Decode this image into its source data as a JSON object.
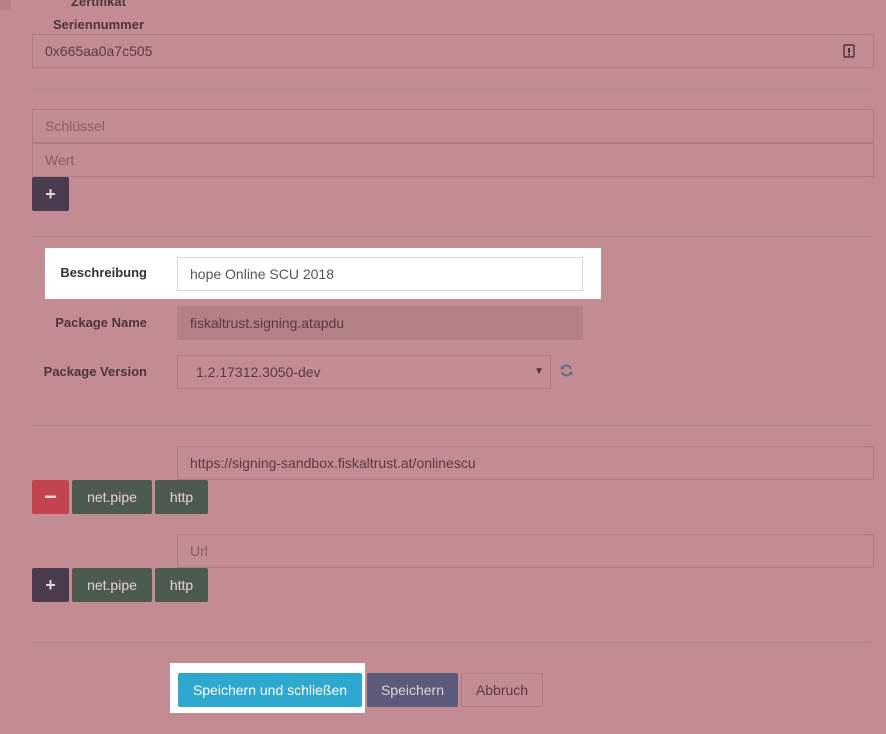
{
  "cert": {
    "label_top": "Zertifikat",
    "label": "Seriennummer",
    "value": "0x665aa0a7c505",
    "icon": "clipboard-icon"
  },
  "keyvalue": {
    "key_placeholder": "Schlüssel",
    "value_placeholder": "Wert",
    "add_label": "+"
  },
  "form": {
    "description_label": "Beschreibung",
    "description_value": "hope Online SCU 2018",
    "package_name_label": "Package Name",
    "package_name_value": "fiskaltrust.signing.atapdu",
    "package_version_label": "Package Version",
    "package_version_value": "1.2.17312.3050-dev",
    "refresh_icon": "refresh-icon"
  },
  "urls": {
    "existing_url": "https://signing-sandbox.fiskaltrust.at/onlinescu",
    "remove_label": "−",
    "netpipe_label": "net.pipe",
    "http_label": "http",
    "new_url_placeholder": "Url",
    "add_label": "+"
  },
  "actions": {
    "save_close": "Speichern und schließen",
    "save": "Speichern",
    "cancel": "Abbruch"
  },
  "colors": {
    "overlay": "#c38c92",
    "primary": "#2fa8cf",
    "danger": "#c3434f",
    "success": "#4d5b4f"
  }
}
